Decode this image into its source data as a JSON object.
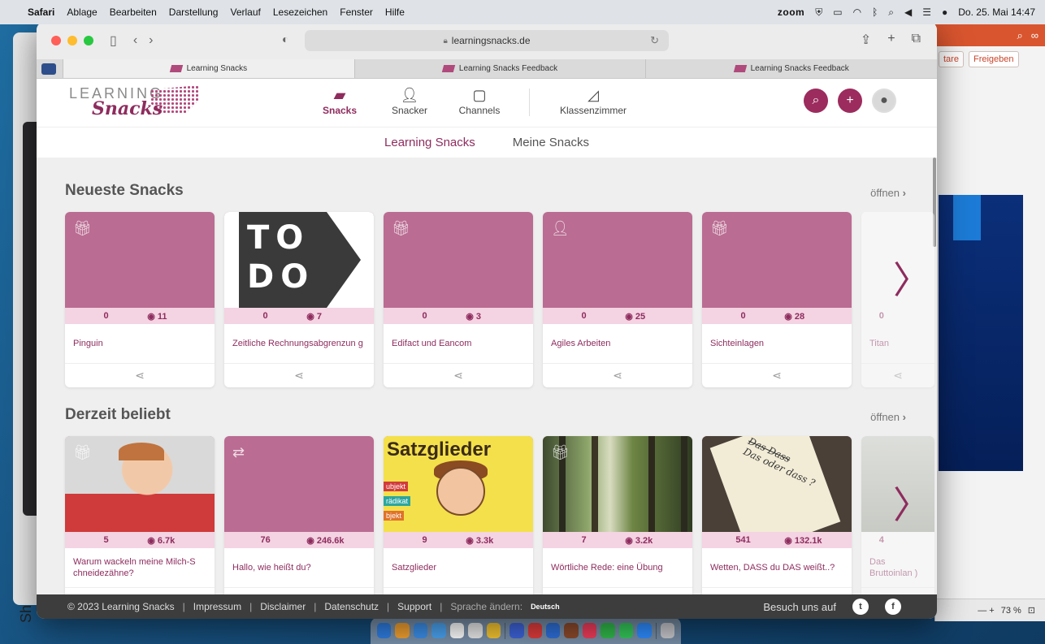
{
  "menubar": {
    "app": "Safari",
    "items": [
      "Ablage",
      "Bearbeiten",
      "Darstellung",
      "Verlauf",
      "Lesezeichen",
      "Fenster",
      "Hilfe"
    ],
    "zoom": "zoom",
    "datetime": "Do. 25. Mai  14:47"
  },
  "bgapp": {
    "btn1": "tare",
    "btn2": "Freigeben",
    "zoom": "73 %"
  },
  "sidetext": "Sh",
  "browser": {
    "url": "learningsnacks.de",
    "tabs": [
      {
        "label": "Learning Snacks"
      },
      {
        "label": "Learning Snacks Feedback"
      },
      {
        "label": "Learning Snacks Feedback"
      }
    ]
  },
  "site": {
    "logo_top": "LEARNING",
    "logo_bottom": "Snacks",
    "nav": [
      {
        "label": "Snacks",
        "icon": "flag-icon"
      },
      {
        "label": "Snacker",
        "icon": "person-icon"
      },
      {
        "label": "Channels",
        "icon": "tv-icon"
      },
      {
        "label": "Klassenzimmer",
        "icon": "teacher-icon"
      }
    ],
    "subnav": [
      "Learning Snacks",
      "Meine Snacks"
    ]
  },
  "sections": [
    {
      "title": "Neueste Snacks",
      "open": "öffnen",
      "cards": [
        {
          "title": "Pinguin",
          "likes": "0",
          "views": "11"
        },
        {
          "title": "Zeitliche Rechnungsabgrenzun g",
          "likes": "0",
          "views": "7"
        },
        {
          "title": "Edifact und Eancom",
          "likes": "0",
          "views": "3"
        },
        {
          "title": "Agiles Arbeiten",
          "likes": "0",
          "views": "25"
        },
        {
          "title": "Sichteinlagen",
          "likes": "0",
          "views": "28"
        },
        {
          "title": "Titan",
          "likes": "0",
          "views": ""
        }
      ]
    },
    {
      "title": "Derzeit beliebt",
      "open": "öffnen",
      "cards": [
        {
          "title": "Warum wackeln meine Milch-S chneidezähne?",
          "likes": "5",
          "views": "6.7k"
        },
        {
          "title": "Hallo, wie heißt du?",
          "likes": "76",
          "views": "246.6k"
        },
        {
          "title": "Satzglieder",
          "likes": "9",
          "views": "3.3k"
        },
        {
          "title": "Wörtliche Rede: eine Übung",
          "likes": "7",
          "views": "3.2k"
        },
        {
          "title": "Wetten, DASS du DAS weißt..?",
          "likes": "541",
          "views": "132.1k"
        },
        {
          "title": "Das Bruttoinlan )",
          "likes": "4",
          "views": ""
        }
      ]
    }
  ],
  "thumbs": {
    "todo_line1": "TO",
    "todo_line2": "DO",
    "satz_title": "Satzglieder",
    "satz_labels": [
      "ubjekt",
      "rädikat",
      "bjekt"
    ],
    "note_text": "Das oder dass ?",
    "note_top": "Das Dass"
  },
  "footer": {
    "copyright": "© 2023 Learning Snacks",
    "links": [
      "Impressum",
      "Disclaimer",
      "Datenschutz",
      "Support"
    ],
    "lang_label": "Sprache ändern:",
    "lang": "Deutsch",
    "visit": "Besuch uns auf"
  },
  "colors": {
    "brand": "#8e2c5e",
    "thumb": "#ba6c92",
    "stats": "#f4d3e2"
  }
}
